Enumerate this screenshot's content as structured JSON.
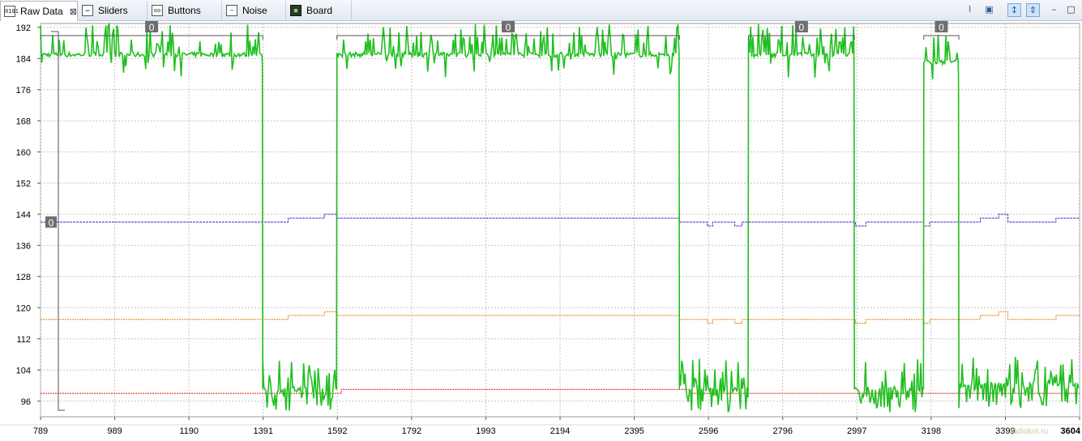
{
  "tabs": [
    {
      "label": "Raw Data",
      "icon": "raw-data-icon",
      "active": true,
      "closable": true
    },
    {
      "label": "Sliders",
      "icon": "sliders-icon",
      "active": false
    },
    {
      "label": "Buttons",
      "icon": "buttons-icon",
      "active": false
    },
    {
      "label": "Noise",
      "icon": "noise-icon",
      "active": false
    },
    {
      "label": "Board",
      "icon": "board-icon",
      "active": false
    }
  ],
  "toolbar": {
    "buttons": [
      "chart-view-icon",
      "table-view-icon",
      "fit-vertical-icon",
      "fit-all-icon",
      "minimize-icon",
      "maximize-icon"
    ]
  },
  "watermark": "radiokot.ru",
  "chart_data": {
    "type": "line",
    "xlim": [
      789,
      3604
    ],
    "ylim": [
      92,
      193
    ],
    "yticks": [
      96,
      104,
      112,
      120,
      128,
      136,
      144,
      152,
      160,
      168,
      176,
      184,
      192
    ],
    "xticks": [
      "789",
      "989",
      "1190",
      "1391",
      "1592",
      "1792",
      "1993",
      "2194",
      "2395",
      "2596",
      "2796",
      "2997",
      "3198",
      "3399",
      "3604"
    ],
    "grid": true,
    "colors": {
      "raw": "#1fbf1f",
      "baseline": "#5a1fd0",
      "threshold": "#ee7a00",
      "reference": "#e01010"
    },
    "segments": [
      {
        "x": [
          789,
          1391
        ],
        "level": 185,
        "label": "0"
      },
      {
        "x": [
          1391,
          1592
        ],
        "level": 99
      },
      {
        "x": [
          1592,
          2520
        ],
        "level": 185,
        "label": "0"
      },
      {
        "x": [
          2520,
          2707
        ],
        "level": 99
      },
      {
        "x": [
          2707,
          2994
        ],
        "level": 185,
        "label": "0"
      },
      {
        "x": [
          2994,
          3182
        ],
        "level": 99
      },
      {
        "x": [
          3182,
          3277
        ],
        "level": 183,
        "label": "0"
      },
      {
        "x": [
          3277,
          3604
        ],
        "level": 100
      }
    ],
    "series": [
      {
        "name": "baseline",
        "color": "#5a1fd0",
        "points": [
          [
            789,
            142
          ],
          [
            1460,
            142
          ],
          [
            1460,
            143
          ],
          [
            1558,
            143
          ],
          [
            1558,
            144
          ],
          [
            1592,
            144
          ],
          [
            1592,
            143
          ],
          [
            2520,
            143
          ],
          [
            2520,
            142
          ],
          [
            2596,
            142
          ],
          [
            2596,
            141
          ],
          [
            2610,
            141
          ],
          [
            2610,
            142
          ],
          [
            2670,
            142
          ],
          [
            2670,
            141
          ],
          [
            2690,
            141
          ],
          [
            2690,
            142
          ],
          [
            2997,
            142
          ],
          [
            2997,
            141
          ],
          [
            3025,
            141
          ],
          [
            3025,
            142
          ],
          [
            3182,
            142
          ],
          [
            3182,
            141
          ],
          [
            3198,
            141
          ],
          [
            3198,
            142
          ],
          [
            3335,
            142
          ],
          [
            3335,
            143
          ],
          [
            3385,
            143
          ],
          [
            3385,
            144
          ],
          [
            3410,
            144
          ],
          [
            3410,
            142
          ],
          [
            3540,
            142
          ],
          [
            3540,
            143
          ],
          [
            3604,
            143
          ]
        ]
      },
      {
        "name": "threshold",
        "color": "#ee7a00",
        "points": [
          [
            789,
            117
          ],
          [
            1460,
            117
          ],
          [
            1460,
            118
          ],
          [
            1558,
            118
          ],
          [
            1558,
            119
          ],
          [
            1592,
            119
          ],
          [
            1592,
            118
          ],
          [
            2520,
            118
          ],
          [
            2520,
            117
          ],
          [
            2596,
            117
          ],
          [
            2596,
            116
          ],
          [
            2610,
            116
          ],
          [
            2610,
            117
          ],
          [
            2670,
            117
          ],
          [
            2670,
            116
          ],
          [
            2690,
            116
          ],
          [
            2690,
            117
          ],
          [
            2997,
            117
          ],
          [
            2997,
            116
          ],
          [
            3025,
            116
          ],
          [
            3025,
            117
          ],
          [
            3182,
            117
          ],
          [
            3182,
            116
          ],
          [
            3198,
            116
          ],
          [
            3198,
            117
          ],
          [
            3335,
            117
          ],
          [
            3335,
            118
          ],
          [
            3385,
            118
          ],
          [
            3385,
            119
          ],
          [
            3410,
            119
          ],
          [
            3410,
            117
          ],
          [
            3540,
            117
          ],
          [
            3540,
            118
          ],
          [
            3604,
            118
          ]
        ]
      },
      {
        "name": "reference",
        "color": "#e01010",
        "points": [
          [
            789,
            98
          ],
          [
            1604,
            98
          ],
          [
            1604,
            99
          ],
          [
            2550,
            99
          ],
          [
            2550,
            98
          ],
          [
            3604,
            98
          ]
        ]
      }
    ],
    "markers": [
      {
        "x": 789,
        "y": 142,
        "label": "0"
      }
    ]
  }
}
